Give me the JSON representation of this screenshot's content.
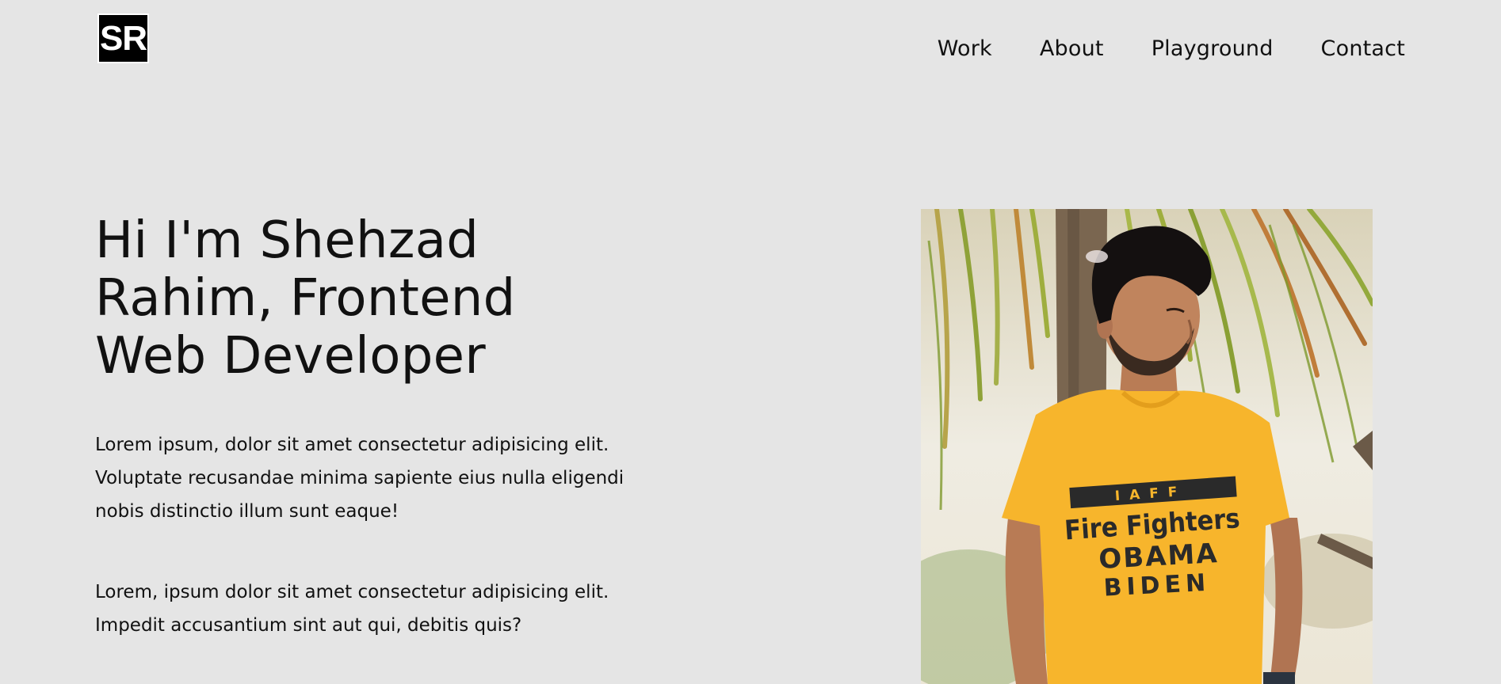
{
  "header": {
    "logo_text": "SR",
    "nav": [
      {
        "label": "Work"
      },
      {
        "label": "About"
      },
      {
        "label": "Playground"
      },
      {
        "label": "Contact"
      }
    ]
  },
  "hero": {
    "title": "Hi I'm Shehzad Rahim, Frontend Web Developer",
    "paragraphs": [
      "Lorem ipsum, dolor sit amet consectetur adipisicing elit. Voluptate recusandae minima sapiente eius nulla eligendi nobis distinctio illum sunt eaque!",
      "Lorem, ipsum dolor sit amet consectetur adipisicing elit. Impedit accusantium sint aut qui, debitis quis?"
    ]
  },
  "photo": {
    "shirt_lines": [
      "IAFF",
      "Fire Fighters",
      "OBAMA",
      "BIDEN"
    ]
  },
  "colors": {
    "background": "#e5e5e5",
    "logo_bg": "#000000",
    "text": "#111111",
    "shirt": "#f7b52c"
  }
}
